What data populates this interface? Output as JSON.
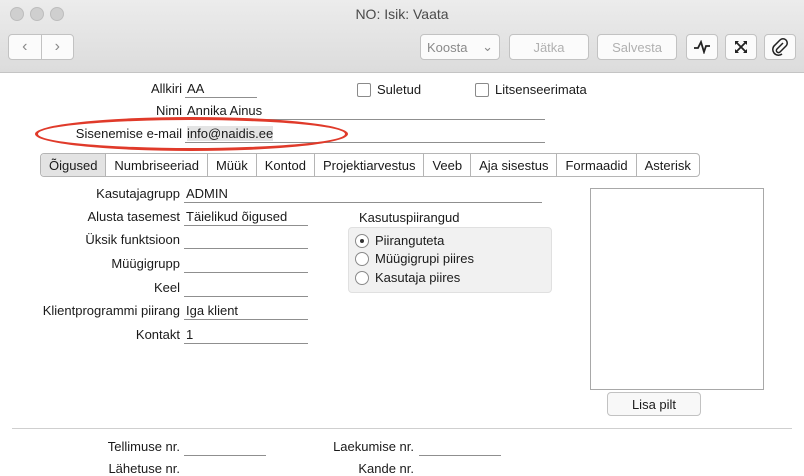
{
  "window": {
    "title": "NO: Isik: Vaata"
  },
  "toolbar": {
    "back": "‹",
    "forward": "›",
    "create": "Koosta",
    "create_arrow": "⌄",
    "continue": "Jätka",
    "save": "Salvesta",
    "icons": [
      "activity-icon",
      "expand-icon",
      "paperclip-icon"
    ]
  },
  "header": {
    "signature_label": "Allkiri",
    "signature_value": "AA",
    "name_label": "Nimi",
    "name_value": "Annika Ainus",
    "email_label": "Sisenemise e-mail",
    "email_value": "info@naidis.ee",
    "closed_label": "Suletud",
    "closed_checked": false,
    "unlicensed_label": "Litsenseerimata",
    "unlicensed_checked": false
  },
  "tabs": [
    "Õigused",
    "Numbriseeriad",
    "Müük",
    "Kontod",
    "Projektiarvestus",
    "Veeb",
    "Aja sisestus",
    "Formaadid",
    "Asterisk"
  ],
  "rights": {
    "usergroup_label": "Kasutajagrupp",
    "usergroup_value": "ADMIN",
    "startlevel_label": "Alusta tasemest",
    "startlevel_value": "Täielikud õigused",
    "singlefunc_label": "Üksik funktsioon",
    "singlefunc_value": "",
    "salesgroup_label": "Müügigrupp",
    "salesgroup_value": "",
    "language_label": "Keel",
    "language_value": "",
    "clientlimit_label": "Klientprogrammi piirang",
    "clientlimit_value": "Iga klient",
    "contact_label": "Kontakt",
    "contact_value": "1"
  },
  "restrictions": {
    "title": "Kasutuspiirangud",
    "options": [
      "Piiranguteta",
      "Müügigrupi piires",
      "Kasutaja piires"
    ],
    "selected": 0
  },
  "picture": {
    "add_label": "Lisa pilt"
  },
  "footer": {
    "order_label": "Tellimuse nr.",
    "order_value": "",
    "receipt_label": "Laekumise nr.",
    "receipt_value": "",
    "dispatch_label": "Lähetuse nr.",
    "entry_label": "Kande nr."
  },
  "colors": {
    "annotation": "#e03a2a"
  }
}
